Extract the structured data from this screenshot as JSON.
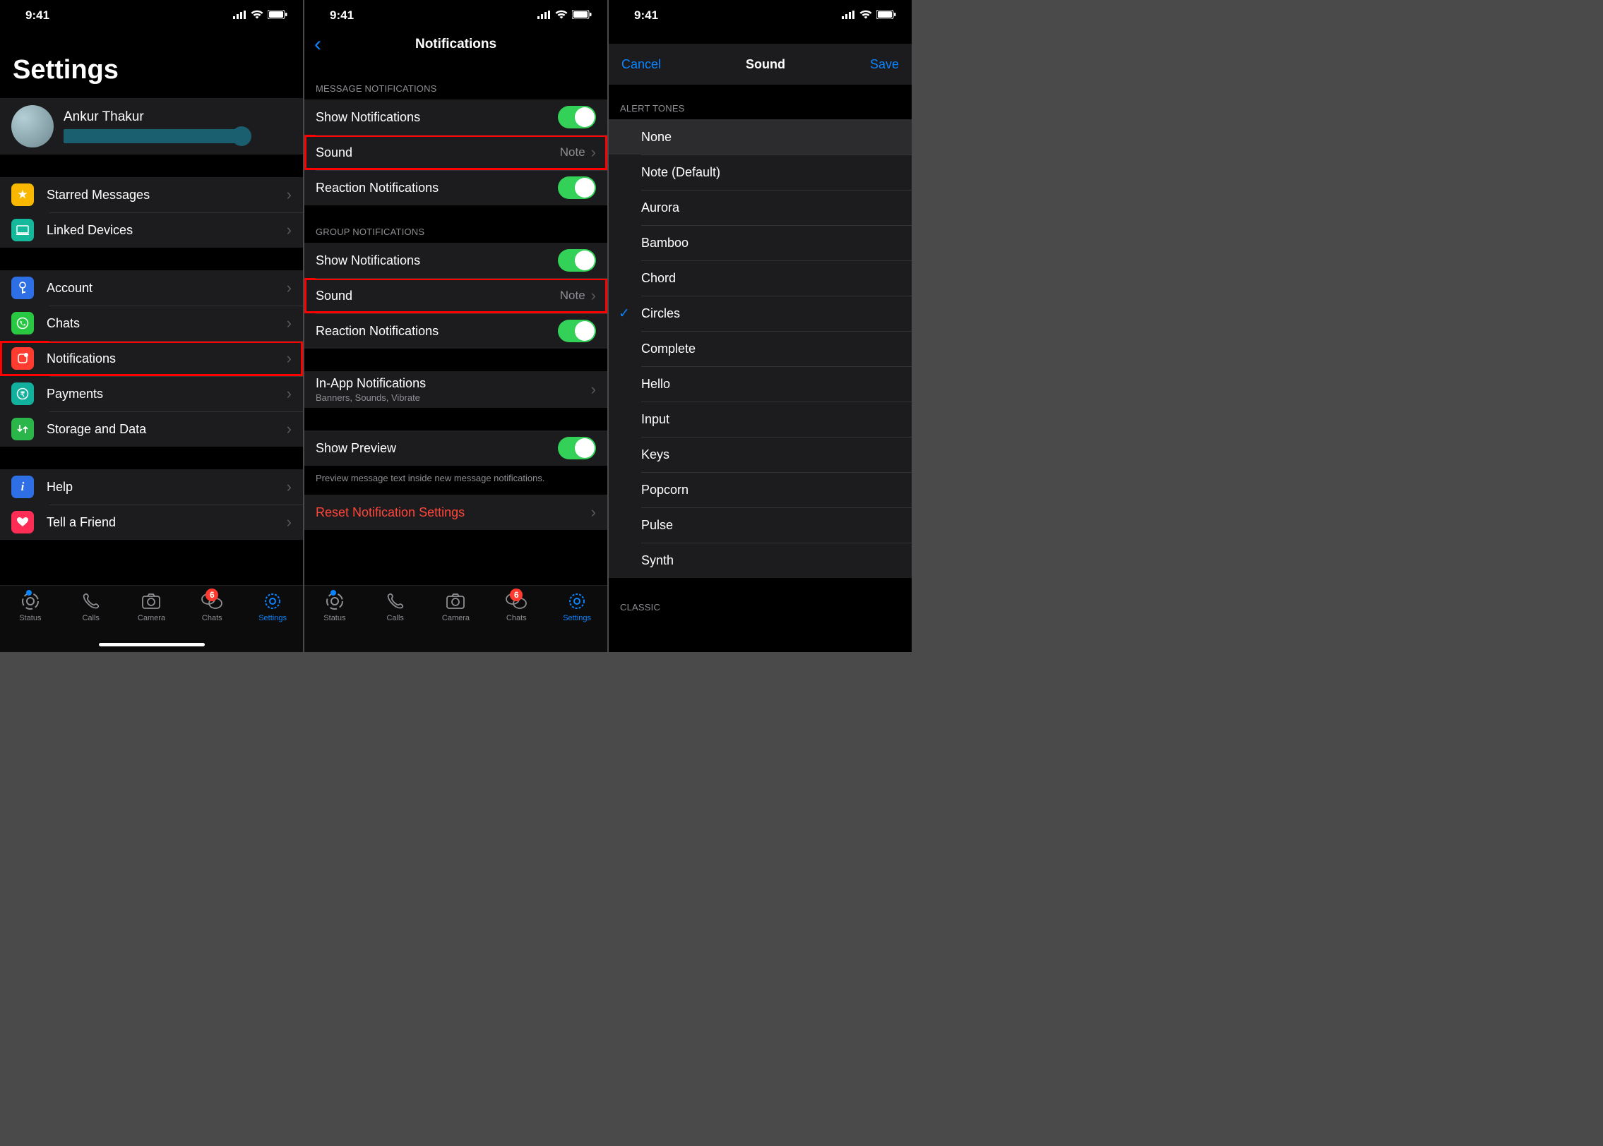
{
  "status": {
    "time": "9:41"
  },
  "screen1": {
    "title": "Settings",
    "profile": {
      "name": "Ankur Thakur"
    },
    "group1": [
      {
        "label": "Starred Messages"
      },
      {
        "label": "Linked Devices"
      }
    ],
    "group2": [
      {
        "label": "Account"
      },
      {
        "label": "Chats"
      },
      {
        "label": "Notifications"
      },
      {
        "label": "Payments"
      },
      {
        "label": "Storage and Data"
      }
    ],
    "group3": [
      {
        "label": "Help"
      },
      {
        "label": "Tell a Friend"
      }
    ]
  },
  "screen2": {
    "nav_title": "Notifications",
    "msg_header": "MESSAGE NOTIFICATIONS",
    "grp_header": "GROUP NOTIFICATIONS",
    "show_notifications": "Show Notifications",
    "sound": "Sound",
    "sound_value": "Note",
    "reaction": "Reaction Notifications",
    "inapp_title": "In-App Notifications",
    "inapp_sub": "Banners, Sounds, Vibrate",
    "show_preview": "Show Preview",
    "preview_footer": "Preview message text inside new message notifications.",
    "reset": "Reset Notification Settings"
  },
  "screen3": {
    "cancel": "Cancel",
    "title": "Sound",
    "save": "Save",
    "alert_header": "ALERT TONES",
    "tones": [
      "None",
      "Note (Default)",
      "Aurora",
      "Bamboo",
      "Chord",
      "Circles",
      "Complete",
      "Hello",
      "Input",
      "Keys",
      "Popcorn",
      "Pulse",
      "Synth"
    ],
    "selected": "Circles",
    "classic_header": "CLASSIC"
  },
  "tabs": {
    "status": "Status",
    "calls": "Calls",
    "camera": "Camera",
    "chats": "Chats",
    "settings": "Settings",
    "chats_badge": "6"
  }
}
